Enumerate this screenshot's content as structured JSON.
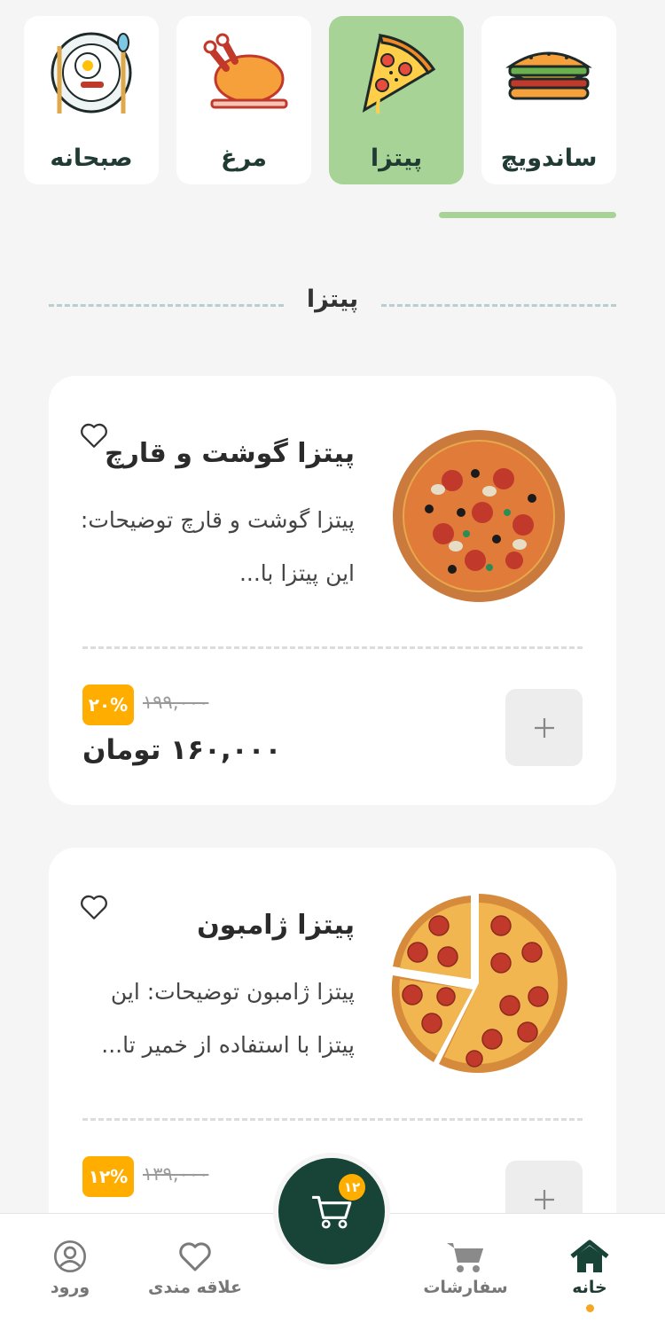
{
  "categories": [
    {
      "label": "ساندویچ",
      "icon": "sandwich-icon",
      "active": false
    },
    {
      "label": "پیتزا",
      "icon": "pizza-icon",
      "active": true
    },
    {
      "label": "مرغ",
      "icon": "chicken-icon",
      "active": false
    },
    {
      "label": "صبحانه",
      "icon": "breakfast-icon",
      "active": false
    }
  ],
  "section": {
    "title": "پیتزا"
  },
  "products": [
    {
      "name": "پیتزا گوشت و قارچ",
      "desc": "پیتزا گوشت و قارچ توضیحات: این پیتزا با...",
      "old_price": "۱۹۹,۰۰۰",
      "discount": "۲۰%",
      "price": "۱۶۰,۰۰۰ تومان",
      "add_label": "+"
    },
    {
      "name": "پیتزا ژامبون",
      "desc": "پیتزا ژامبون توضیحات: این پیتزا با استفاده از خمیر تا...",
      "old_price": "۱۳۹,۰۰۰",
      "discount": "۱۲%",
      "price": "",
      "add_label": "+"
    }
  ],
  "cart": {
    "count": "۱۲"
  },
  "nav": {
    "home": "خانه",
    "orders": "سفارشات",
    "favorites": "علاقه مندی",
    "login": "ورود"
  },
  "colors": {
    "accent_green": "#a7d496",
    "dark_green": "#174437",
    "orange": "#ffae00"
  }
}
